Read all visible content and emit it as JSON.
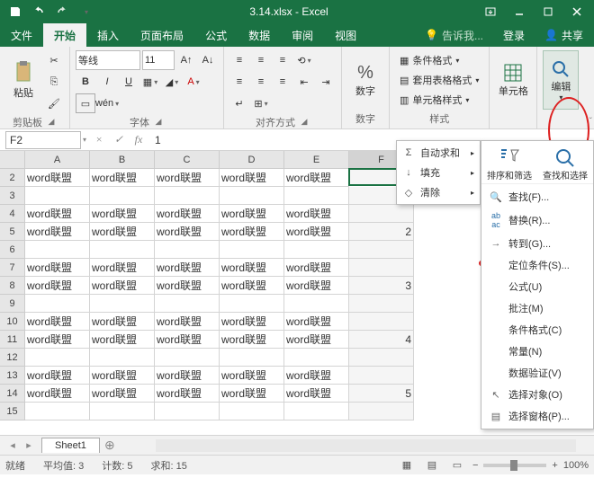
{
  "titlebar": {
    "title": "3.14.xlsx - Excel"
  },
  "tabs": {
    "file": "文件",
    "home": "开始",
    "insert": "插入",
    "layout": "页面布局",
    "formulas": "公式",
    "data": "数据",
    "review": "审阅",
    "view": "视图",
    "tellme": "告诉我...",
    "login": "登录",
    "share": "共享"
  },
  "ribbon": {
    "clipboard": {
      "label": "剪贴板",
      "paste": "粘贴"
    },
    "font": {
      "label": "字体",
      "name": "等线",
      "size": "11"
    },
    "alignment": {
      "label": "对齐方式"
    },
    "number": {
      "label": "数字",
      "btn": "数字",
      "fmt": "%"
    },
    "styles": {
      "label": "样式",
      "conditional": "条件格式",
      "table": "套用表格格式",
      "cell": "单元格样式"
    },
    "cells": {
      "label": "单元格"
    },
    "editing": {
      "label": "编辑"
    }
  },
  "formula_bar": {
    "name": "F2",
    "value": "1"
  },
  "grid": {
    "cols": [
      "A",
      "B",
      "C",
      "D",
      "E",
      "F"
    ],
    "rows": [
      2,
      3,
      4,
      5,
      6,
      7,
      8,
      9,
      10,
      11,
      12,
      13,
      14,
      15
    ],
    "text": "word联盟",
    "fvals": {
      "2": "1",
      "5": "2",
      "8": "3",
      "11": "4",
      "14": "5"
    },
    "text_rows": [
      2,
      4,
      5,
      7,
      8,
      10,
      11,
      13,
      14
    ]
  },
  "dropdown1": {
    "autosum": "自动求和",
    "fill": "填充",
    "clear": "清除"
  },
  "panel2": {
    "sort": "排序和筛选",
    "find": "查找和选择",
    "items": {
      "lookup": "查找(F)...",
      "replace": "替换(R)...",
      "goto": "转到(G)...",
      "special": "定位条件(S)...",
      "formulas": "公式(U)",
      "comments": "批注(M)",
      "condfmt": "条件格式(C)",
      "constants": "常量(N)",
      "validation": "数据验证(V)",
      "selectobj": "选择对象(O)",
      "selpane": "选择窗格(P)..."
    }
  },
  "sheets": {
    "s1": "Sheet1"
  },
  "status": {
    "ready": "就绪",
    "avg_l": "平均值:",
    "avg": "3",
    "count_l": "计数:",
    "count": "5",
    "sum_l": "求和:",
    "sum": "15",
    "zoom": "100%"
  }
}
